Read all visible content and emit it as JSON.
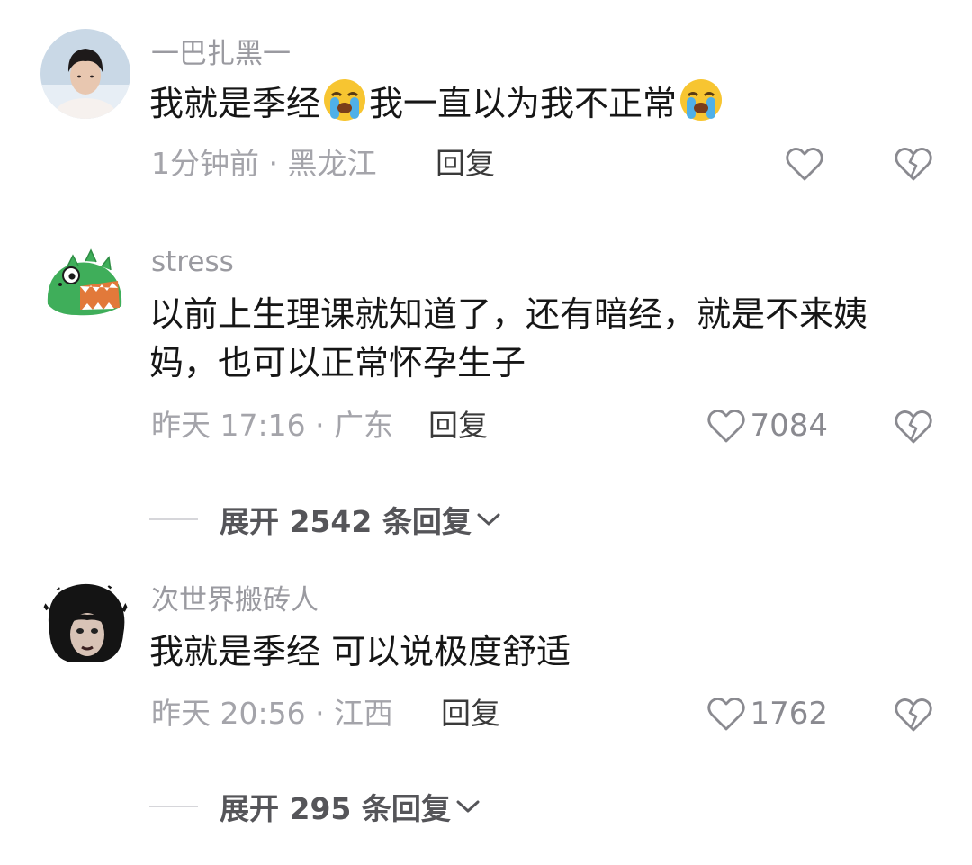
{
  "comments": [
    {
      "username": "一巴扎黑一",
      "text_parts": [
        "我就是季经",
        "我一直以为我不正常"
      ],
      "emoji": "loudly-crying-face",
      "time": "1分钟前",
      "location": "黑龙江",
      "meta": "1分钟前 · 黑龙江",
      "reply": "回复",
      "likes": ""
    },
    {
      "username": "stress",
      "text": "以前上生理课就知道了，还有暗经，就是不来姨妈，也可以正常怀孕生子",
      "time": "昨天 17:16",
      "location": "广东",
      "meta": "昨天 17:16 · 广东",
      "reply": "回复",
      "likes": "7084",
      "expand": "展开 2542 条回复"
    },
    {
      "username": "次世界搬砖人",
      "text": "我就是季经 可以说极度舒适",
      "time": "昨天 20:56",
      "location": "江西",
      "meta": "昨天 20:56 · 江西",
      "reply": "回复",
      "likes": "1762",
      "expand": "展开 295 条回复"
    }
  ],
  "icons": {
    "like": "heart-outline-icon",
    "dislike": "broken-heart-icon",
    "expand": "chevron-down-icon"
  },
  "colors": {
    "text": "#161616",
    "muted": "#9a9aa0",
    "avatar_dino": "#3fae5a"
  }
}
